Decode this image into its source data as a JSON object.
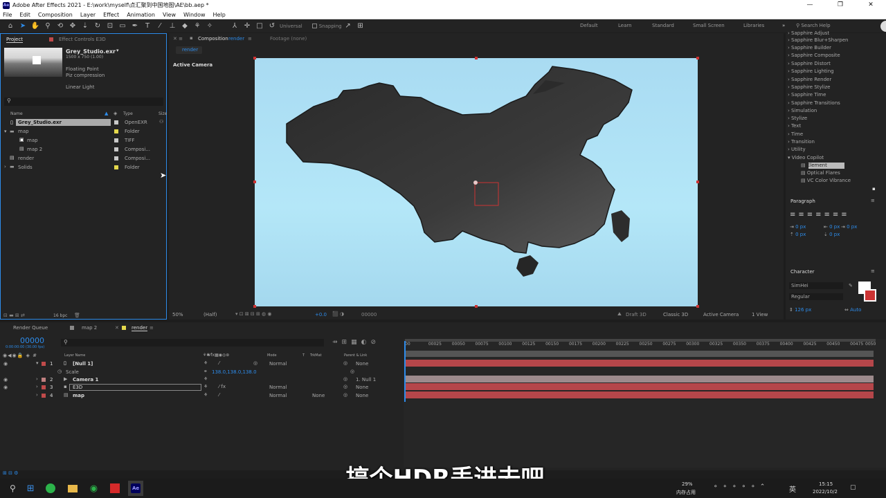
{
  "titlebar": {
    "title": "Adobe After Effects 2021 - E:\\work\\myself\\点汇聚到中国地图\\AE\\bb.aep *",
    "logo": "Ae",
    "minimize": "—",
    "maximize": "❐",
    "close": "✕"
  },
  "menubar": [
    "File",
    "Edit",
    "Composition",
    "Layer",
    "Effect",
    "Animation",
    "View",
    "Window",
    "Help"
  ],
  "toolbar": {
    "universal": "Universal",
    "snapping": "Snapping",
    "workspaces": [
      "Default",
      "Learn",
      "Standard",
      "Small Screen",
      "Libraries"
    ],
    "search": "Search Help"
  },
  "project": {
    "tab_project": "Project",
    "tab_effect_controls": "Effect Controls E3D",
    "asset_name": "Grey_Studio.exr",
    "asset_dims": "1500 x 750 (1.00)",
    "asset_format": "Floating Point",
    "asset_compression": "Piz compression",
    "asset_color": "Linear Light",
    "col_name": "Name",
    "col_type": "Type",
    "col_size": "Size",
    "items": [
      {
        "name": "Grey_Studio.exr",
        "type": "OpenEXR",
        "color": "#c8c8c8"
      },
      {
        "name": "map",
        "type": "Folder",
        "color": "#e4d84c"
      },
      {
        "name": "map",
        "type": "TIFF",
        "color": "#c8c8c8"
      },
      {
        "name": "map 2",
        "type": "Composi...",
        "color": "#c8c8c8"
      },
      {
        "name": "render",
        "type": "Composi...",
        "color": "#c8c8c8"
      },
      {
        "name": "Solids",
        "type": "Folder",
        "color": "#e4d84c"
      }
    ],
    "bpc": "16 bpc"
  },
  "comp": {
    "tab": "Composition",
    "tab_name": "render",
    "footage": "Footage (none)",
    "subtab": "render",
    "active_camera": "Active Camera",
    "zoom": "50%",
    "resolution": "(Half)",
    "exposure": "+0.0",
    "timecode": "00000",
    "draft3d": "Draft 3D",
    "renderer": "Classic 3D",
    "camera": "Active Camera",
    "views": "1 View"
  },
  "effects": [
    "Sapphire Adjust",
    "Sapphire Blur+Sharpen",
    "Sapphire Builder",
    "Sapphire Composite",
    "Sapphire Distort",
    "Sapphire Lighting",
    "Sapphire Render",
    "Sapphire Stylize",
    "Sapphire Time",
    "Sapphire Transitions",
    "Simulation",
    "Stylize",
    "Text",
    "Time",
    "Transition",
    "Utility",
    "Video Copilot"
  ],
  "effects_sub": [
    "Element",
    "Optical Flares",
    "VC Color Vibrance"
  ],
  "paragraph": {
    "title": "Paragraph",
    "px": "0 px"
  },
  "character": {
    "title": "Character",
    "font": "SimHei",
    "style": "Regular",
    "size": "126 px",
    "auto": "Auto"
  },
  "timeline": {
    "tabs": [
      "Render Queue",
      "map 2",
      "render"
    ],
    "timecode": "00000",
    "timecode_sub": "0:00:00:00 (30.00 fps)",
    "cols": {
      "layer_name": "Layer Name",
      "mode": "Mode",
      "t": "T",
      "trkmat": "TrkMat",
      "parent": "Parent & Link"
    },
    "ruler": [
      "00",
      "00025",
      "00050",
      "00075",
      "00100",
      "00125",
      "00150",
      "00175",
      "00200",
      "00225",
      "00250",
      "00275",
      "00300",
      "00325",
      "00350",
      "00375",
      "00400",
      "00425",
      "00450",
      "00475",
      "0050"
    ],
    "layers": [
      {
        "num": "1",
        "name": "[Null 1]",
        "mode": "Normal",
        "trkmat": "",
        "parent": "None",
        "color": "#c04a4a",
        "bar": "#b5464a"
      },
      {
        "num": "",
        "name": "Scale",
        "mode": "",
        "trkmat": "",
        "parent": "",
        "value": "138.0,138.0,138.0",
        "color": "",
        "bar": ""
      },
      {
        "num": "2",
        "name": "Camera 1",
        "mode": "",
        "trkmat": "",
        "parent": "1. Null 1",
        "color": "#c08080",
        "bar": "#9c8a8c"
      },
      {
        "num": "3",
        "name": "E3D",
        "mode": "Normal",
        "trkmat": "",
        "parent": "None",
        "color": "#c04a4a",
        "bar": "#b5464a"
      },
      {
        "num": "4",
        "name": "map",
        "mode": "Normal",
        "trkmat": "None",
        "parent": "None",
        "color": "#c04a4a",
        "bar": "#b5464a"
      }
    ]
  },
  "subtitle": "搞个HDR丢进去吧",
  "taskbar": {
    "cpu": "29%",
    "mem": "内存占用",
    "time": "15:15",
    "date": "2022/10/2",
    "ime": "英"
  }
}
